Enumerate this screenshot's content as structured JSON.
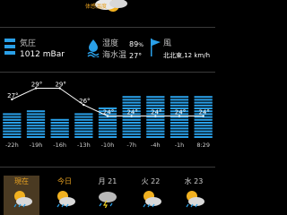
{
  "header": {
    "feels_like_label": "体感温度"
  },
  "conditions": {
    "pressure": {
      "label": "気圧",
      "value": "1012 mBar"
    },
    "humidity": {
      "label": "湿度",
      "value": "89",
      "unit": "%"
    },
    "water_temp": {
      "label": "海水温",
      "value": "27°"
    },
    "wind": {
      "label": "風",
      "value": "北北東,12 km/h"
    }
  },
  "chart_data": {
    "type": "line",
    "x": [
      "-22h",
      "-19h",
      "-16h",
      "-13h",
      "-10h",
      "-7h",
      "-4h",
      "-1h",
      "8:29"
    ],
    "temps": [
      27,
      29,
      29,
      26,
      24,
      24,
      24,
      24,
      24
    ],
    "temp_labels": [
      "27°",
      "29°",
      "29°",
      "26°",
      "24°",
      "24°",
      "24°",
      "24°",
      "24°"
    ],
    "bar_levels": [
      0.45,
      0.5,
      0.35,
      0.45,
      0.55,
      0.75,
      0.8,
      0.8,
      0.78
    ]
  },
  "forecast": {
    "tabs": [
      {
        "label": "現在",
        "active": true
      },
      {
        "label": "今日",
        "active": false
      },
      {
        "label": "月 21",
        "active": false
      },
      {
        "label": "火 22",
        "active": false
      },
      {
        "label": "水 23",
        "active": false
      }
    ]
  },
  "colors": {
    "accent": "#e6a020",
    "bar": "#2aa0e8",
    "line": "#ffffff"
  }
}
